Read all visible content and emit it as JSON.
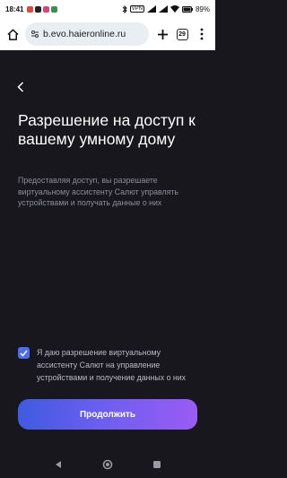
{
  "status_bar": {
    "time": "18:41",
    "battery": "89%",
    "vpn": "VPN"
  },
  "browser": {
    "url": "b.evo.haieronline.ru",
    "tab_count": "29"
  },
  "page": {
    "title": "Разрешение на доступ к вашему умному дому",
    "description": "Предоставляя доступ, вы разрешаете виртуальному ассистенту Салют управлять устройствами и получать данные о них",
    "consent_text": "Я даю разрешение виртуальному ассистенту Салют на управление устройствами и получение данных о них",
    "consent_checked": true,
    "continue_label": "Продолжить"
  },
  "colors": {
    "background": "#17171d",
    "accent": "#4d6cf0"
  }
}
